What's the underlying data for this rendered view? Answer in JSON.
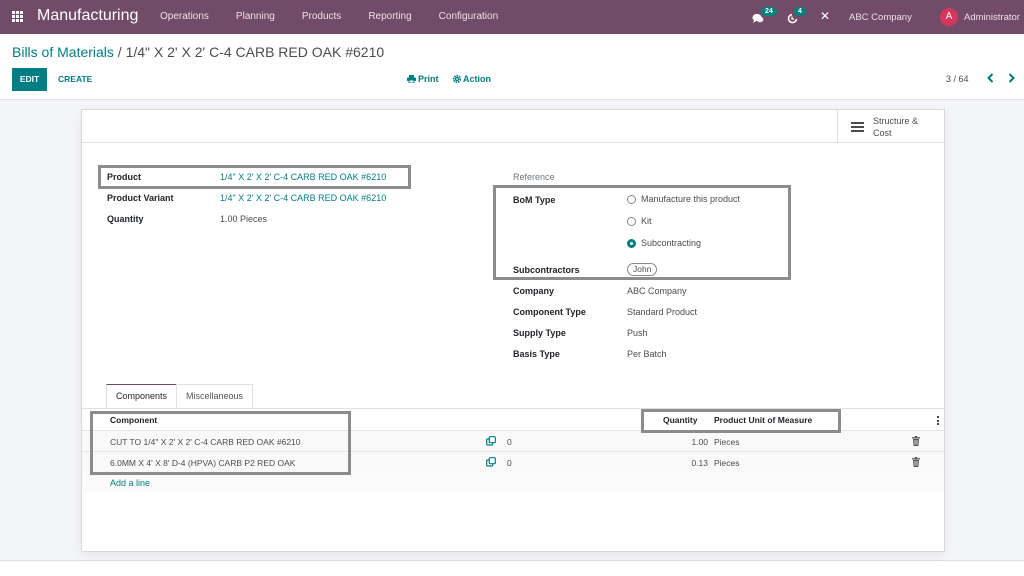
{
  "navbar": {
    "app_name": "Manufacturing",
    "menu": [
      "Operations",
      "Planning",
      "Products",
      "Reporting",
      "Configuration"
    ],
    "chat_count": "24",
    "activity_count": "4",
    "company": "ABC Company",
    "avatar_initial": "A",
    "user": "Administrator"
  },
  "control_panel": {
    "breadcrumb_parent": "Bills of Materials",
    "breadcrumb_separator": " / ",
    "breadcrumb_current": "1/4\" X 2' X 2' C-4 CARB RED OAK #6210",
    "edit_label": "EDIT",
    "create_label": "CREATE",
    "print_label": "Print",
    "action_label": "Action",
    "pager": "3 / 64",
    "pager_prev": "‹",
    "pager_next": "›"
  },
  "smart_button": {
    "label": "Structure & Cost"
  },
  "form": {
    "left": [
      {
        "label": "Product",
        "value": "1/4\" X 2' X 2' C-4 CARB RED OAK #6210"
      },
      {
        "label": "Product Variant",
        "value": "1/4\" X 2' X 2' C-4 CARB RED OAK #6210"
      },
      {
        "label": "Quantity",
        "value": "1.00",
        "unit": "Pieces"
      }
    ],
    "reference_label": "Reference",
    "bom_type": {
      "label": "BoM Type",
      "options": [
        "Manufacture this product",
        "Kit",
        "Subcontracting"
      ],
      "selected": "Subcontracting"
    },
    "subcontractors": {
      "label": "Subcontractors",
      "tags": [
        "John"
      ]
    },
    "right": [
      {
        "label": "Company",
        "value": "ABC Company"
      },
      {
        "label": "Component Type",
        "value": "Standard Product"
      },
      {
        "label": "Supply Type",
        "value": "Push"
      },
      {
        "label": "Basis Type",
        "value": "Per Batch"
      }
    ]
  },
  "tabs": [
    "Components",
    "Miscellaneous"
  ],
  "table": {
    "headers": {
      "component": "Component",
      "quantity": "Quantity",
      "uom": "Product Unit of Measure"
    },
    "rows": [
      {
        "component": "CUT TO 1/4\" X 2' X 2' C-4 CARB RED OAK #6210",
        "count": "0",
        "quantity": "1.00",
        "uom": "Pieces"
      },
      {
        "component": "6.0MM X 4' X 8' D-4 (HPVA) CARB P2 RED OAK",
        "count": "0",
        "quantity": "0.13",
        "uom": "Pieces"
      }
    ],
    "add_line": "Add a line"
  },
  "colors": {
    "navbar": "#714b67",
    "primary": "#017e84",
    "badge": "#00827f",
    "avatar": "#d4375b",
    "highlight_box": "#8c8c8c"
  }
}
